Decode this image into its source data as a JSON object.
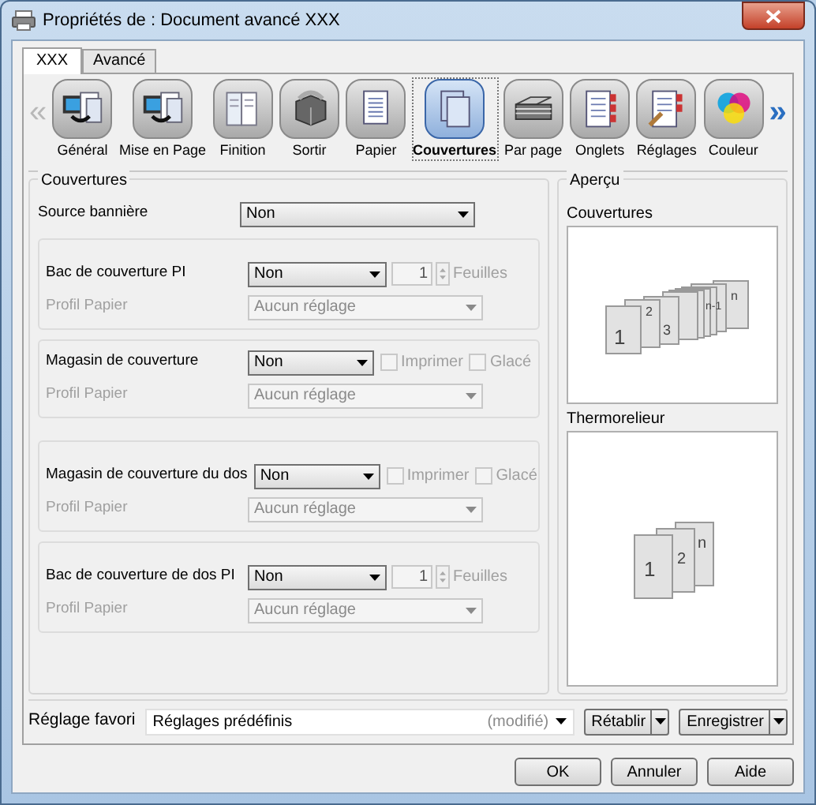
{
  "window": {
    "title": "Propriétés de : Document avancé XXX"
  },
  "tabs": [
    {
      "label": "XXX",
      "selected": true
    },
    {
      "label": "Avancé",
      "selected": false
    }
  ],
  "toolbar": {
    "prev": "«",
    "next": "»",
    "items": [
      {
        "label": "Général",
        "kind": "computer",
        "selected": false
      },
      {
        "label": "Mise en Page",
        "kind": "computer",
        "selected": false
      },
      {
        "label": "Finition",
        "kind": "folded",
        "selected": false
      },
      {
        "label": "Sortir",
        "kind": "box",
        "selected": false
      },
      {
        "label": "Papier",
        "kind": "page",
        "selected": false
      },
      {
        "label": "Couvertures",
        "kind": "cover",
        "selected": true
      },
      {
        "label": "Par page",
        "kind": "tray",
        "selected": false
      },
      {
        "label": "Onglets",
        "kind": "tabbed",
        "selected": false
      },
      {
        "label": "Réglages",
        "kind": "tabbed-tool",
        "selected": false
      },
      {
        "label": "Couleur",
        "kind": "color",
        "selected": false
      }
    ]
  },
  "covers": {
    "title": "Couvertures",
    "source": {
      "label": "Source bannière",
      "value": "Non"
    },
    "sections": [
      {
        "label": "Bac de couverture PI",
        "value": "Non",
        "extra": {
          "kind": "spinner",
          "value": "1",
          "unit": "Feuilles",
          "disabled": true
        },
        "profile": {
          "label": "Profil Papier",
          "value": "Aucun réglage",
          "disabled": true
        }
      },
      {
        "label": "Magasin de couverture",
        "value": "Non",
        "extra": {
          "kind": "checkboxes",
          "items": [
            {
              "label": "Imprimer",
              "checked": false,
              "disabled": true
            },
            {
              "label": "Glacé",
              "checked": false,
              "disabled": true
            }
          ]
        },
        "profile": {
          "label": "Profil Papier",
          "value": "Aucun réglage",
          "disabled": true
        }
      },
      {
        "label": "Magasin de couverture du dos",
        "value": "Non",
        "extra": {
          "kind": "checkboxes",
          "items": [
            {
              "label": "Imprimer",
              "checked": false,
              "disabled": true
            },
            {
              "label": "Glacé",
              "checked": false,
              "disabled": true
            }
          ]
        },
        "profile": {
          "label": "Profil Papier",
          "value": "Aucun réglage",
          "disabled": true
        }
      },
      {
        "label": "Bac de couverture de dos PI",
        "value": "Non",
        "extra": {
          "kind": "spinner",
          "value": "1",
          "unit": "Feuilles",
          "disabled": true
        },
        "profile": {
          "label": "Profil Papier",
          "value": "Aucun réglage",
          "disabled": true
        }
      }
    ]
  },
  "preview": {
    "title": "Aperçu",
    "panels": [
      {
        "label": "Couvertures",
        "kind": "covers",
        "page_labels": [
          "1",
          "2",
          "3",
          "n-1",
          "n"
        ]
      },
      {
        "label": "Thermorelieur",
        "kind": "binder",
        "page_labels": [
          "1",
          "2",
          "n"
        ]
      }
    ]
  },
  "favorite": {
    "label": "Réglage favori",
    "value": "Réglages prédéfinis",
    "note": "(modifié)",
    "buttons": [
      "Rétablir",
      "Enregistrer"
    ]
  },
  "buttons": [
    "OK",
    "Annuler",
    "Aide"
  ]
}
